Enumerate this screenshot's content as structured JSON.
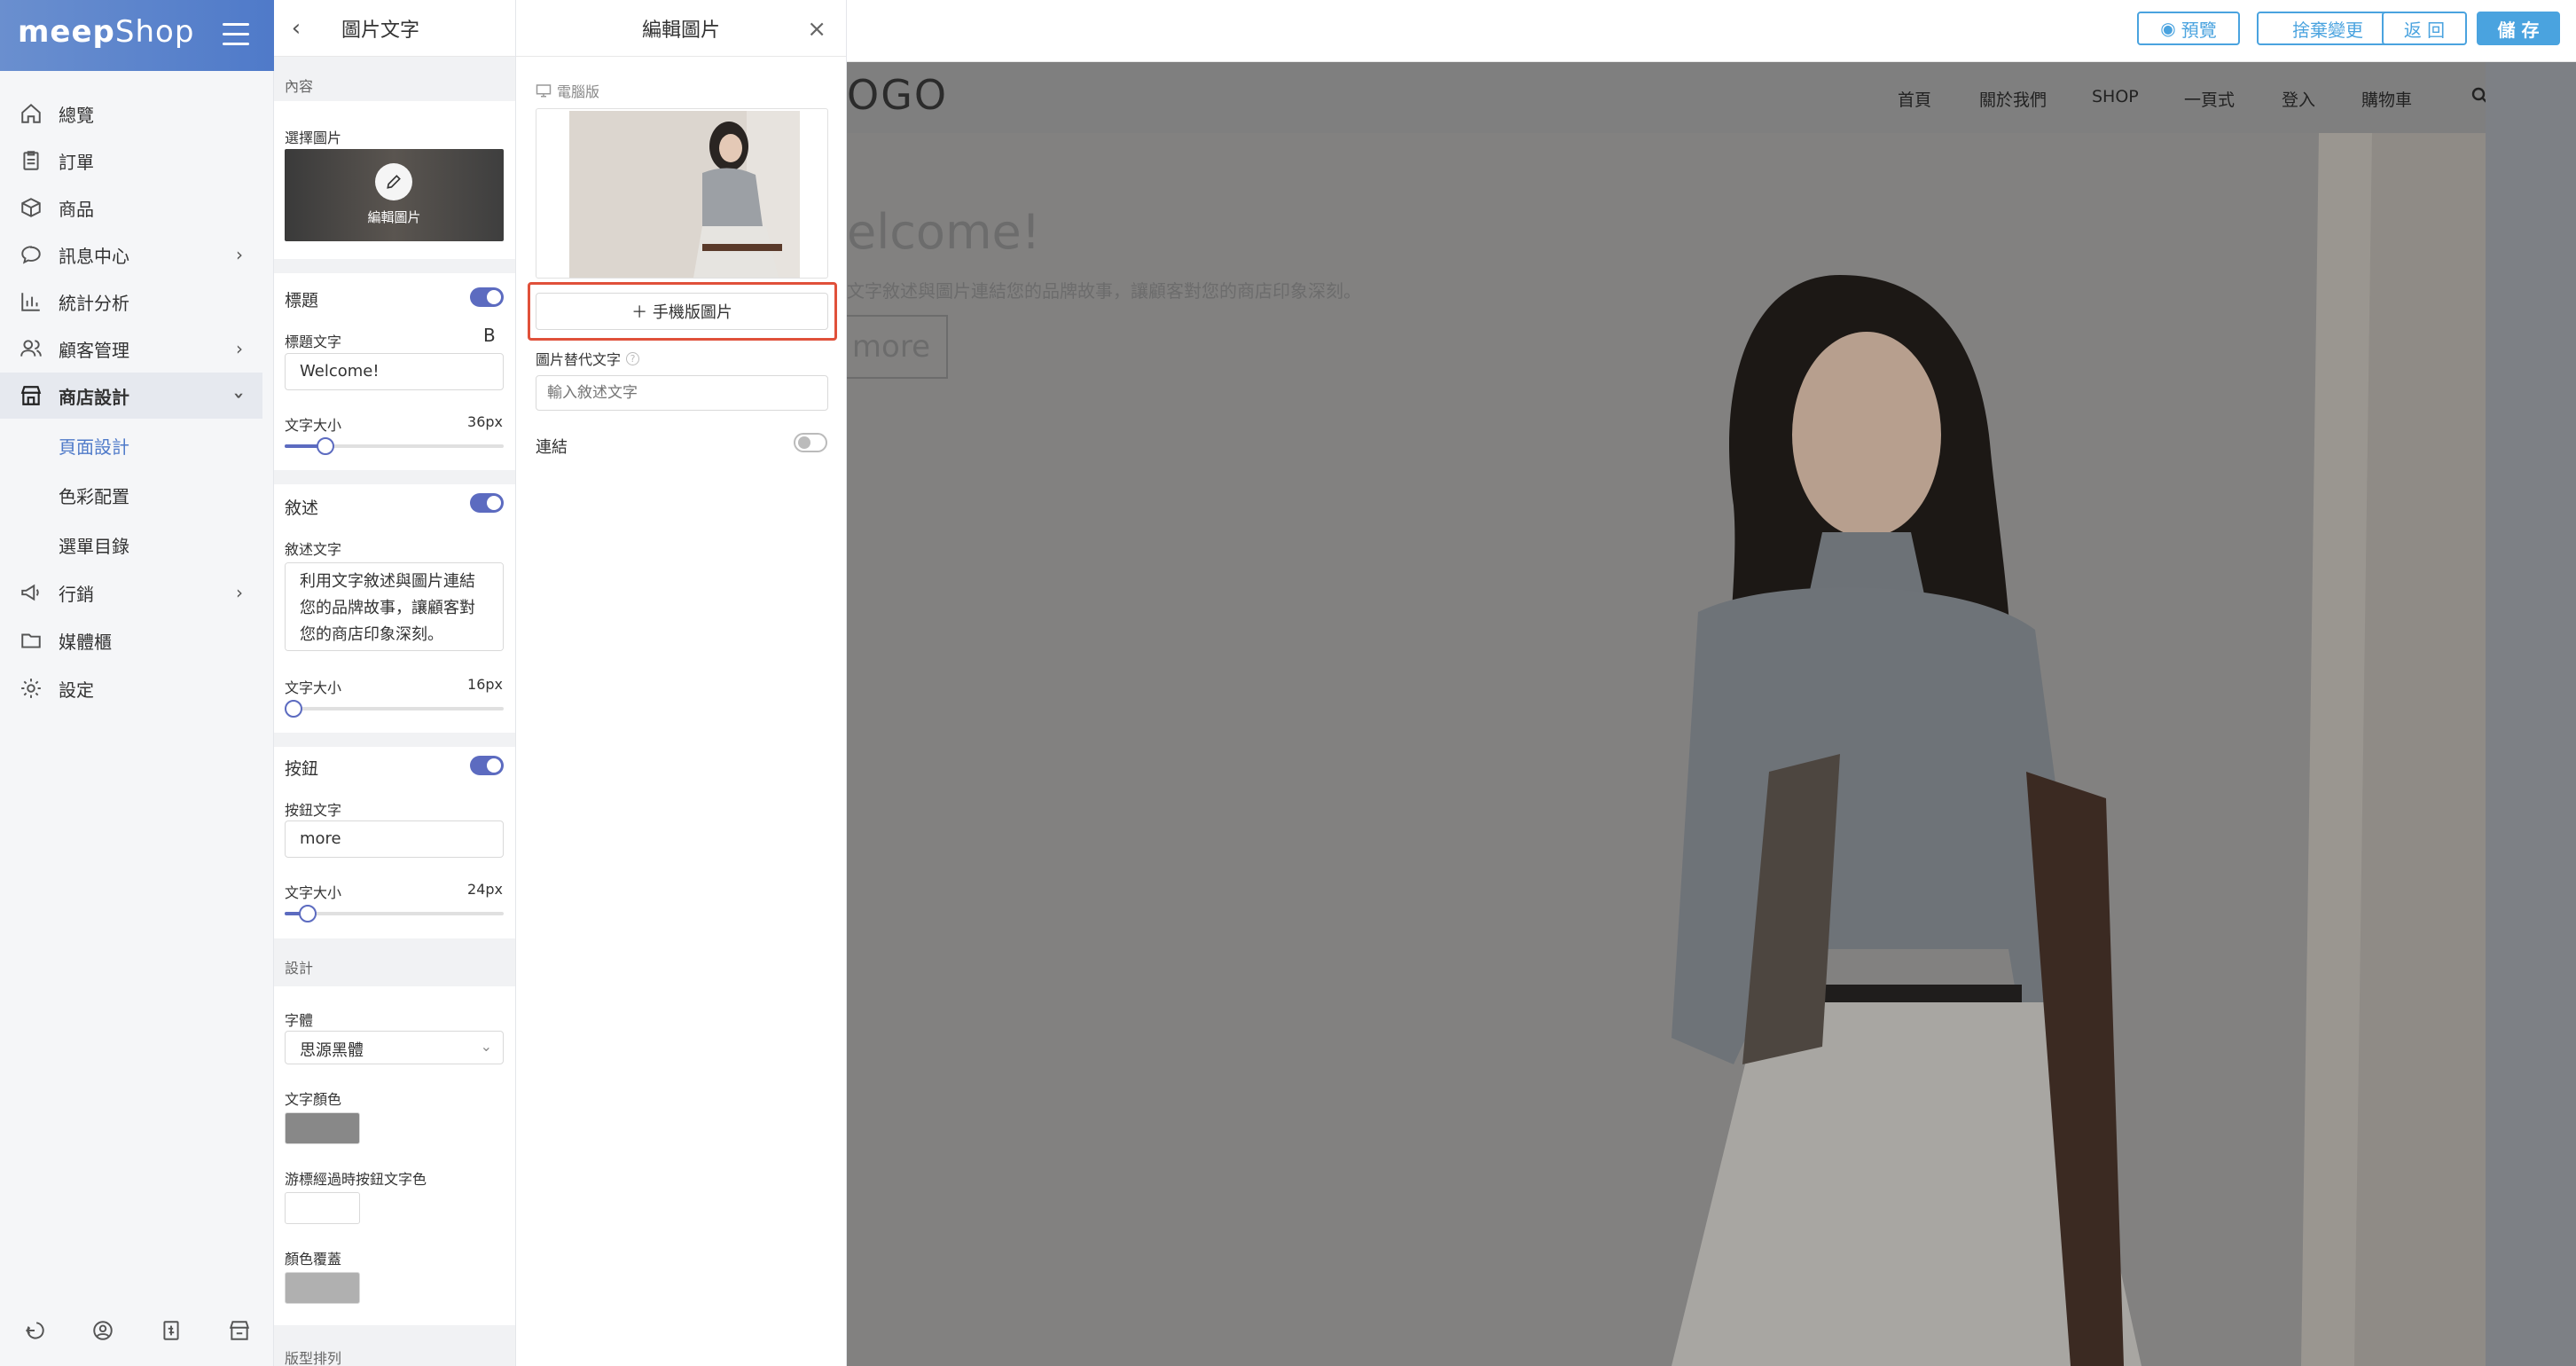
{
  "nav": {
    "logo_bold": "meep",
    "logo_light": "Shop",
    "items": [
      {
        "label": "總覽",
        "icon": "home-icon"
      },
      {
        "label": "訂單",
        "icon": "clipboard-icon"
      },
      {
        "label": "商品",
        "icon": "box-icon"
      },
      {
        "label": "訊息中心",
        "icon": "chat-icon"
      },
      {
        "label": "統計分析",
        "icon": "chart-icon"
      },
      {
        "label": "顧客管理",
        "icon": "users-icon"
      },
      {
        "label": "商店設計",
        "icon": "store-icon"
      },
      {
        "label": "行銷",
        "icon": "megaphone-icon"
      },
      {
        "label": "媒體櫃",
        "icon": "folder-icon"
      },
      {
        "label": "設定",
        "icon": "gear-icon"
      }
    ],
    "subitems": [
      "頁面設計",
      "色彩配置",
      "選單目錄"
    ]
  },
  "panel": {
    "title": "圖片文字",
    "content_section": "內容",
    "select_image_label": "選擇圖片",
    "edit_image_label": "編輯圖片",
    "title_section": "標題",
    "title_text_label": "標題文字",
    "bold_icon": "B",
    "title_value": "Welcome!",
    "font_size_label": "文字大小",
    "title_font_size": "36px",
    "desc_section": "敘述",
    "desc_text_label": "敘述文字",
    "desc_value": "利用文字敘述與圖片連結您的品牌故事，讓顧客對您的商店印象深刻。",
    "desc_font_size": "16px",
    "button_section": "按鈕",
    "button_text_label": "按鈕文字",
    "button_value": "more",
    "button_font_size": "24px",
    "design_section": "設計",
    "font_label": "字體",
    "font_value": "思源黑體",
    "text_color_label": "文字顏色",
    "hover_color_label": "游標經過時按鈕文字色",
    "overlay_label": "顏色覆蓋",
    "layout_label": "版型排列"
  },
  "edit": {
    "title": "編輯圖片",
    "desktop_label": "電腦版",
    "mobile_button": "＋ 手機版圖片",
    "alt_label": "圖片替代文字",
    "alt_placeholder": "輸入敘述文字",
    "link_label": "連結"
  },
  "toolbar": {
    "preview": "預覽",
    "discard": "捨棄變更",
    "back": "返 回",
    "save": "儲 存"
  },
  "store": {
    "logo": "OGO",
    "links": [
      "首頁",
      "關於我們",
      "SHOP",
      "一頁式",
      "登入",
      "購物車"
    ],
    "hero_title": "elcome!",
    "hero_desc": "文字敘述與圖片連結您的品牌故事，讓顧客對您的商店印象深刻。",
    "hero_button": "more"
  },
  "colors": {
    "accent": "#5c6bc0",
    "toolbar_blue": "#4aa3df",
    "highlight": "#e0503a",
    "text_color_swatch": "#888888",
    "overlay_swatch": "#b0b0b0"
  }
}
